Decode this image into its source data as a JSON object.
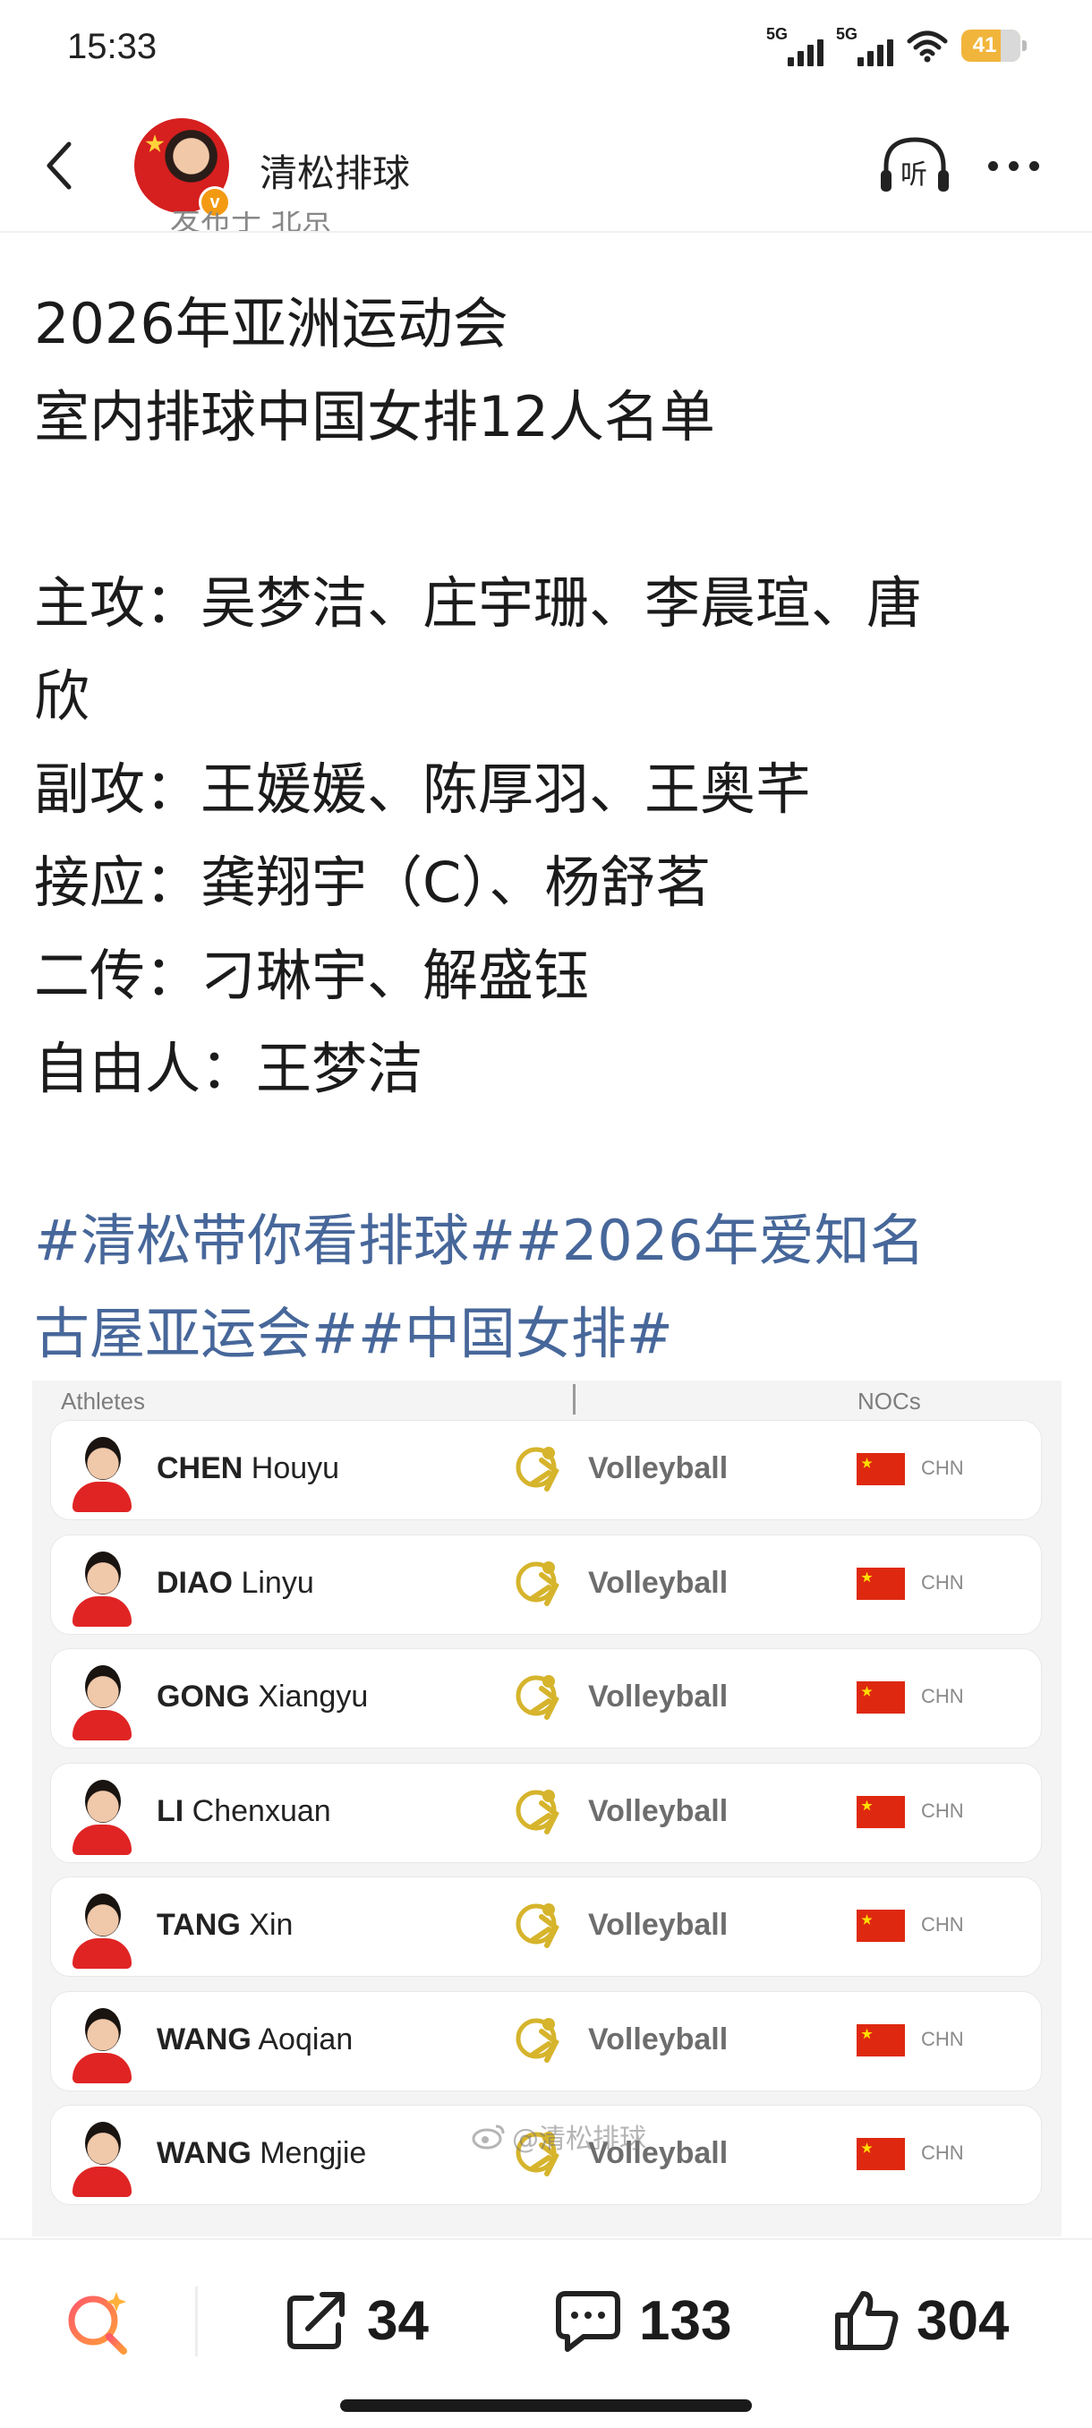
{
  "status_bar": {
    "time": "15:33",
    "network_1": "5G",
    "network_2": "5G",
    "battery": "41"
  },
  "header": {
    "author": "清松排球",
    "verified_badge": "v",
    "listen_label": "听",
    "clipped_meta": "发布于 北京"
  },
  "post": {
    "lines": [
      "2026年亚洲运动会",
      "室内排球中国女排12人名单",
      "",
      "主攻：吴梦洁、庄宇珊、李晨瑄、唐",
      "欣",
      "副攻：王媛媛、陈厚羽、王奥芊",
      "接应：龚翔宇（C）、杨舒茗",
      "二传：刁琳宇、解盛钰",
      "自由人：王梦洁"
    ],
    "hashtags": [
      "#清松带你看排球##2026年爱知名",
      "古屋亚运会##中国女排#"
    ]
  },
  "roster": {
    "col_athletes": "Athletes",
    "col_nocs": "NOCs",
    "watermark": "@清松排球",
    "rows": [
      {
        "surname": "CHEN",
        "given": "Houyu",
        "sport": "Volleyball",
        "noc": "CHN"
      },
      {
        "surname": "DIAO",
        "given": "Linyu",
        "sport": "Volleyball",
        "noc": "CHN"
      },
      {
        "surname": "GONG",
        "given": "Xiangyu",
        "sport": "Volleyball",
        "noc": "CHN"
      },
      {
        "surname": "LI",
        "given": "Chenxuan",
        "sport": "Volleyball",
        "noc": "CHN"
      },
      {
        "surname": "TANG",
        "given": "Xin",
        "sport": "Volleyball",
        "noc": "CHN"
      },
      {
        "surname": "WANG",
        "given": "Aoqian",
        "sport": "Volleyball",
        "noc": "CHN"
      },
      {
        "surname": "WANG",
        "given": "Mengjie",
        "sport": "Volleyball",
        "noc": "CHN"
      }
    ]
  },
  "toolbar": {
    "share_count": "34",
    "comment_count": "133",
    "like_count": "304"
  },
  "colors": {
    "hashtag": "#47679a",
    "flag_red": "#de2910",
    "sport_gold": "#d6b42c",
    "badge_orange": "#f39a12",
    "search_gradient_start": "#ff5a6a",
    "search_gradient_end": "#ff9b3a"
  },
  "icons": {
    "back": "chevron-left-icon",
    "listen": "headphones-icon",
    "more": "more-dots-icon",
    "search": "ai-search-icon",
    "share": "share-icon",
    "comment": "comment-icon",
    "like": "thumbs-up-icon",
    "sport": "volleyball-pictogram-icon",
    "flag": "china-flag-icon"
  }
}
